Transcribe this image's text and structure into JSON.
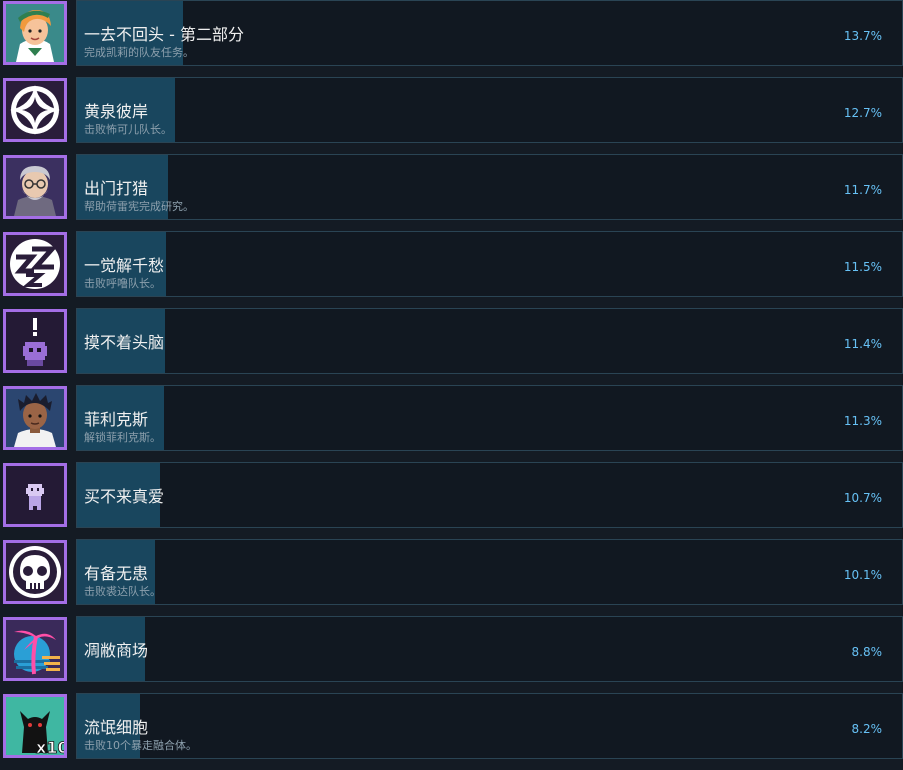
{
  "achievements": [
    {
      "title": "一去不回头 - 第二部分",
      "desc": "完成凯莉的队友任务。",
      "percent": "13.7%",
      "fill": 0.137,
      "icon": "girl-portrait-icon"
    },
    {
      "title": "黄泉彼岸",
      "desc": "击败怖可儿队长。",
      "percent": "12.7%",
      "fill": 0.127,
      "icon": "four-point-star-icon"
    },
    {
      "title": "出门打猎",
      "desc": "帮助荷雷宪完成研究。",
      "percent": "11.7%",
      "fill": 0.117,
      "icon": "old-man-portrait-icon"
    },
    {
      "title": "一觉解千愁",
      "desc": "击败呼噜队长。",
      "percent": "11.5%",
      "fill": 0.115,
      "icon": "zzz-sleep-icon"
    },
    {
      "title": "摸不着头脑",
      "desc": "",
      "percent": "11.4%",
      "fill": 0.114,
      "icon": "confused-sprite-icon"
    },
    {
      "title": "菲利克斯",
      "desc": "解锁菲利克斯。",
      "percent": "11.3%",
      "fill": 0.113,
      "icon": "boy-portrait-icon"
    },
    {
      "title": "买不来真爱",
      "desc": "",
      "percent": "10.7%",
      "fill": 0.107,
      "icon": "ghost-sprite-icon"
    },
    {
      "title": "有备无患",
      "desc": "击败裘达队长。",
      "percent": "10.1%",
      "fill": 0.101,
      "icon": "skull-icon"
    },
    {
      "title": "凋敝商场",
      "desc": "",
      "percent": "8.8%",
      "fill": 0.088,
      "icon": "palm-tree-sunset-icon"
    },
    {
      "title": "流氓细胞",
      "desc": "击败10个暴走融合体。",
      "percent": "8.2%",
      "fill": 0.082,
      "icon": "shadow-creature-x10-icon"
    }
  ]
}
